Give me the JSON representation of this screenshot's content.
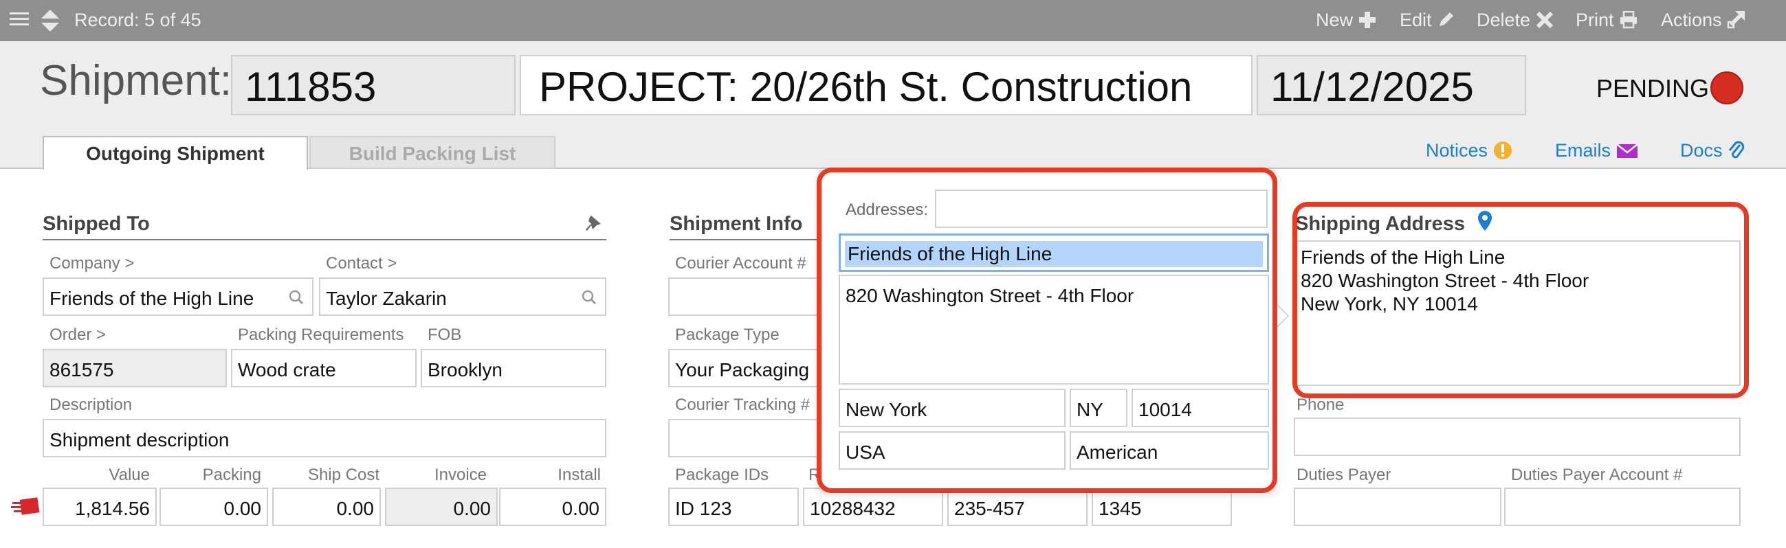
{
  "toolbar": {
    "record": "Record: 5 of 45",
    "new_label": "New",
    "edit_label": "Edit",
    "delete_label": "Delete",
    "print_label": "Print",
    "actions_label": "Actions"
  },
  "header": {
    "label": "Shipment:",
    "shipment_number": "111853",
    "project": "PROJECT: 20/26th St. Construction",
    "date": "11/12/2025",
    "status": "PENDING",
    "status_color": "#d62d20"
  },
  "tabs": [
    {
      "label": "Outgoing Shipment",
      "active": true
    },
    {
      "label": "Build Packing List",
      "active": false
    }
  ],
  "header_links": {
    "notices": "Notices",
    "emails": "Emails",
    "docs": "Docs"
  },
  "shipped_to": {
    "title": "Shipped To",
    "company_label": "Company >",
    "company_value": "Friends of the High Line",
    "contact_label": "Contact >",
    "contact_value": "Taylor Zakarin",
    "order_label": "Order >",
    "order_value": "861575",
    "packing_req_label": "Packing Requirements",
    "packing_req_value": "Wood crate",
    "fob_label": "FOB",
    "fob_value": "Brooklyn",
    "description_label": "Description",
    "description_value": "Shipment description",
    "money_labels": [
      "Value",
      "Packing",
      "Ship Cost",
      "Invoice",
      "Install"
    ],
    "money_values": [
      "1,814.56",
      "0.00",
      "0.00",
      "0.00",
      "0.00"
    ]
  },
  "shipment_info": {
    "title": "Shipment Info",
    "courier_account_label": "Courier Account #",
    "courier_account_value": "",
    "package_type_label": "Package Type",
    "package_type_value": "Your Packaging",
    "tracking_label": "Courier Tracking #",
    "tracking_value": "",
    "package_ids_label": "Package IDs",
    "r_label": "R",
    "package_ids": [
      "ID 123",
      "10288432",
      "235-457",
      "1345"
    ]
  },
  "address_popover": {
    "addresses_label": "Addresses:",
    "addresses_value": "",
    "name": "Friends of the High Line",
    "street": "820 Washington Street - 4th Floor",
    "city": "New York",
    "state": "NY",
    "zip": "10014",
    "country": "USA",
    "nationality": "American"
  },
  "shipping_address": {
    "title": "Shipping Address",
    "line1": "Friends of the High Line",
    "line2": "820 Washington Street - 4th Floor",
    "line3": "New York, NY 10014",
    "phone_label": "Phone",
    "phone_value": "",
    "duties_payer_label": "Duties Payer",
    "duties_payer_value": "",
    "duties_account_label": "Duties Payer Account #",
    "duties_account_value": ""
  },
  "colors": {
    "toolbar_bg": "#8f8f8f",
    "link_blue": "#1c7fc9",
    "highlight_red": "#e63a22",
    "selection_blue": "#b3d4fd"
  }
}
